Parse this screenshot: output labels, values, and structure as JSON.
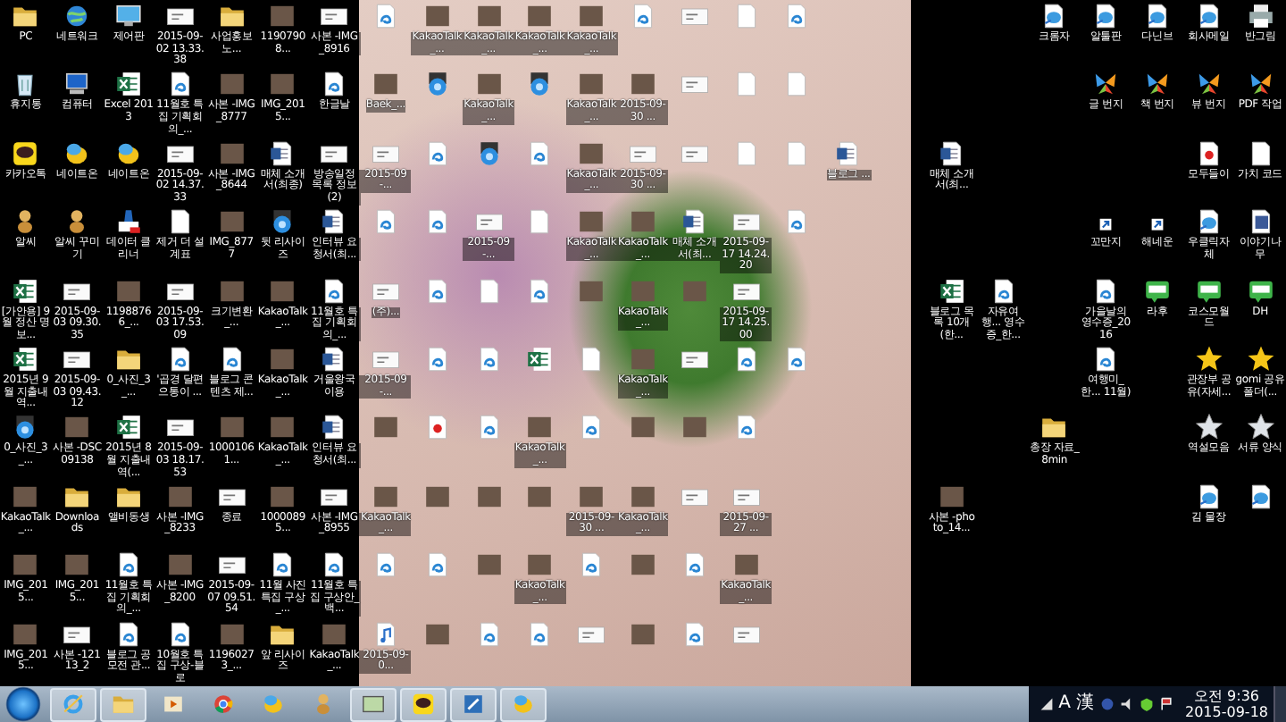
{
  "desktop": {
    "rows": [
      [
        {
          "kind": "folder",
          "label": "PC"
        },
        {
          "kind": "globe",
          "label": "네트워크"
        },
        {
          "kind": "monitor",
          "label": "제어판"
        },
        {
          "kind": "image",
          "label": "2015-09-02 13.33.38"
        },
        {
          "kind": "folder",
          "label": "사업홍보노..."
        },
        {
          "kind": "photo",
          "label": "11907908..."
        },
        {
          "kind": "image",
          "label": "사본 -IMG_8916"
        },
        {
          "kind": "edoc"
        },
        {
          "kind": "photo",
          "label": "KakaoTalk_..."
        },
        {
          "kind": "photo",
          "label": "KakaoTalk_..."
        },
        {
          "kind": "photo",
          "label": "KakaoTalk_..."
        },
        {
          "kind": "photo",
          "label": "KakaoTalk_..."
        },
        {
          "kind": "edoc"
        },
        {
          "kind": "image"
        },
        {
          "kind": "blank"
        },
        {
          "kind": "edoc"
        },
        {
          "kind": "empty"
        },
        {
          "kind": "empty"
        },
        {
          "kind": "empty"
        },
        {
          "kind": "empty"
        },
        {
          "kind": "ie",
          "label": "크롬자"
        },
        {
          "kind": "ie",
          "label": "알툴판"
        },
        {
          "kind": "ie",
          "label": "다닌브"
        },
        {
          "kind": "ie",
          "label": "회사메일"
        },
        {
          "kind": "printer",
          "label": "반그림"
        }
      ],
      [
        {
          "kind": "recycle",
          "label": "휴지통"
        },
        {
          "kind": "computer",
          "label": "컴퓨터"
        },
        {
          "kind": "excel",
          "label": "Excel 2013"
        },
        {
          "kind": "edoc",
          "label": "11월호 특집 기획회의_..."
        },
        {
          "kind": "photo",
          "label": "사본 -IMG_8777"
        },
        {
          "kind": "photo",
          "label": "IMG_2015..."
        },
        {
          "kind": "edoc",
          "label": "한글날"
        },
        {
          "kind": "photo",
          "label": "Baek_..."
        },
        {
          "kind": "zip"
        },
        {
          "kind": "photo",
          "label": "KakaoTalk_..."
        },
        {
          "kind": "zip"
        },
        {
          "kind": "photo",
          "label": "KakaoTalk_..."
        },
        {
          "kind": "photo",
          "label": "2015-09-30 ..."
        },
        {
          "kind": "image"
        },
        {
          "kind": "blank"
        },
        {
          "kind": "blank"
        },
        {
          "kind": "empty"
        },
        {
          "kind": "empty"
        },
        {
          "kind": "empty"
        },
        {
          "kind": "empty"
        },
        {
          "kind": "empty"
        },
        {
          "kind": "msn",
          "label": "글 번지"
        },
        {
          "kind": "msn",
          "label": "책 번지"
        },
        {
          "kind": "msn",
          "label": "뷰 번지"
        },
        {
          "kind": "msn",
          "label": "PDF 작업"
        }
      ],
      [
        {
          "kind": "kakao",
          "label": "카카오톡"
        },
        {
          "kind": "nateon",
          "label": "네이트온"
        },
        {
          "kind": "nateon",
          "label": "네이트온"
        },
        {
          "kind": "image",
          "label": "2015-09-02 14.37.33"
        },
        {
          "kind": "photo",
          "label": "사본 -IMG_8644"
        },
        {
          "kind": "word",
          "label": "매체 소개서(최종)"
        },
        {
          "kind": "image",
          "label": "방송일정 목록 정보(2)"
        },
        {
          "kind": "image",
          "label": "2015-09-..."
        },
        {
          "kind": "edoc"
        },
        {
          "kind": "zip"
        },
        {
          "kind": "edoc"
        },
        {
          "kind": "photo",
          "label": "KakaoTalk_..."
        },
        {
          "kind": "image",
          "label": "2015-09-30 ..."
        },
        {
          "kind": "image"
        },
        {
          "kind": "blank"
        },
        {
          "kind": "blank"
        },
        {
          "kind": "word",
          "label": "블로그 ..."
        },
        {
          "kind": "empty"
        },
        {
          "kind": "word",
          "label": "매체 소개서(최..."
        },
        {
          "kind": "empty"
        },
        {
          "kind": "empty"
        },
        {
          "kind": "empty"
        },
        {
          "kind": "empty"
        },
        {
          "kind": "pdf",
          "label": "모두들이"
        },
        {
          "kind": "blank",
          "label": "가치 코드"
        }
      ],
      [
        {
          "kind": "alsee",
          "label": "알씨"
        },
        {
          "kind": "alsee",
          "label": "알씨 꾸미기"
        },
        {
          "kind": "cleaner",
          "label": "데이터 클리너"
        },
        {
          "kind": "blank",
          "label": "제거 더 설계표"
        },
        {
          "kind": "photo",
          "label": "IMG_8777"
        },
        {
          "kind": "zip",
          "label": "뒷 리사이즈"
        },
        {
          "kind": "word",
          "label": "인터뷰 요청서(최..."
        },
        {
          "kind": "edoc"
        },
        {
          "kind": "edoc"
        },
        {
          "kind": "image",
          "label": "2015-09-..."
        },
        {
          "kind": "blank"
        },
        {
          "kind": "photo",
          "label": "KakaoTalk_..."
        },
        {
          "kind": "photo",
          "label": "KakaoTalk_..."
        },
        {
          "kind": "word",
          "label": "매체 소개서(최..."
        },
        {
          "kind": "image",
          "label": "2015-09-17 14.24.20"
        },
        {
          "kind": "edoc"
        },
        {
          "kind": "empty"
        },
        {
          "kind": "empty"
        },
        {
          "kind": "empty"
        },
        {
          "kind": "empty"
        },
        {
          "kind": "empty"
        },
        {
          "kind": "shortcut",
          "label": "꼬만지"
        },
        {
          "kind": "shortcut",
          "label": "해네운"
        },
        {
          "kind": "ie",
          "label": "우클릭자체"
        },
        {
          "kind": "facebook",
          "label": "이야기나무"
        }
      ],
      [
        {
          "kind": "excel",
          "label": "[가안용] 9월 정산 명보..."
        },
        {
          "kind": "image",
          "label": "2015-09-03 09.30.35"
        },
        {
          "kind": "photo",
          "label": "11988766_..."
        },
        {
          "kind": "image",
          "label": "2015-09-03 17.53.09"
        },
        {
          "kind": "photo",
          "label": "크기변환_..."
        },
        {
          "kind": "photo",
          "label": "KakaoTalk_..."
        },
        {
          "kind": "edoc",
          "label": "11월호 특집 기획회의_..."
        },
        {
          "kind": "image",
          "label": "(주)..."
        },
        {
          "kind": "edoc"
        },
        {
          "kind": "blank"
        },
        {
          "kind": "edoc"
        },
        {
          "kind": "photo"
        },
        {
          "kind": "photo",
          "label": "KakaoTalk_..."
        },
        {
          "kind": "photo"
        },
        {
          "kind": "image",
          "label": "2015-09-17 14.25.00"
        },
        {
          "kind": "empty"
        },
        {
          "kind": "empty"
        },
        {
          "kind": "empty"
        },
        {
          "kind": "excel",
          "label": "블로그 목록 10개 (한..."
        },
        {
          "kind": "edoc",
          "label": "자유여행... 영수증_한..."
        },
        {
          "kind": "empty"
        },
        {
          "kind": "edoc",
          "label": "가을날의 영수증_2016"
        },
        {
          "kind": "blog",
          "label": "라후"
        },
        {
          "kind": "blog",
          "label": "코스모월드"
        },
        {
          "kind": "blog",
          "label": "DH"
        }
      ],
      [
        {
          "kind": "excel",
          "label": "2015년 9월 지출내역..."
        },
        {
          "kind": "image",
          "label": "2015-09-03 09.43.12"
        },
        {
          "kind": "folder",
          "label": "0_사진_3_..."
        },
        {
          "kind": "edoc",
          "label": "'곱경 달편 으통이 ..."
        },
        {
          "kind": "edoc",
          "label": "블로그 콘텐츠 제..."
        },
        {
          "kind": "photo",
          "label": "KakaoTalk_..."
        },
        {
          "kind": "word",
          "label": "거울왕국이용"
        },
        {
          "kind": "image",
          "label": "2015-09-..."
        },
        {
          "kind": "edoc"
        },
        {
          "kind": "edoc"
        },
        {
          "kind": "excel"
        },
        {
          "kind": "blank"
        },
        {
          "kind": "photo",
          "label": "KakaoTalk_..."
        },
        {
          "kind": "image"
        },
        {
          "kind": "edoc"
        },
        {
          "kind": "edoc"
        },
        {
          "kind": "empty"
        },
        {
          "kind": "empty"
        },
        {
          "kind": "empty"
        },
        {
          "kind": "empty"
        },
        {
          "kind": "empty"
        },
        {
          "kind": "edoc",
          "label": "여행미_한... 11월)"
        },
        {
          "kind": "empty"
        },
        {
          "kind": "star",
          "label": "관장부 공유(자세..."
        },
        {
          "kind": "star",
          "label": "gomi 공유폴더(..."
        }
      ],
      [
        {
          "kind": "zip",
          "label": "0_사진_3_..."
        },
        {
          "kind": "photo",
          "label": "사본 -DSC09138"
        },
        {
          "kind": "excel",
          "label": "2015년 8월 지출내역(..."
        },
        {
          "kind": "image",
          "label": "2015-09-03 18.17.53"
        },
        {
          "kind": "photo",
          "label": "10001061..."
        },
        {
          "kind": "photo",
          "label": "KakaoTalk_..."
        },
        {
          "kind": "word",
          "label": "인터뷰 요청서(최..."
        },
        {
          "kind": "photo"
        },
        {
          "kind": "pdf"
        },
        {
          "kind": "edoc"
        },
        {
          "kind": "photo",
          "label": "KakaoTalk_..."
        },
        {
          "kind": "edoc"
        },
        {
          "kind": "photo"
        },
        {
          "kind": "photo"
        },
        {
          "kind": "edoc"
        },
        {
          "kind": "empty"
        },
        {
          "kind": "empty"
        },
        {
          "kind": "empty"
        },
        {
          "kind": "empty"
        },
        {
          "kind": "empty"
        },
        {
          "kind": "folder",
          "label": "총장 자료_8min"
        },
        {
          "kind": "empty"
        },
        {
          "kind": "empty"
        },
        {
          "kind": "starout",
          "label": "역설모음"
        },
        {
          "kind": "starout",
          "label": "서류 양식"
        }
      ],
      [
        {
          "kind": "photo",
          "label": "KakaoTalk_..."
        },
        {
          "kind": "folder",
          "label": "Downloads"
        },
        {
          "kind": "folder",
          "label": "앨비동생"
        },
        {
          "kind": "photo",
          "label": "사본 -IMG_8233"
        },
        {
          "kind": "image",
          "label": "종료"
        },
        {
          "kind": "photo",
          "label": "10000895..."
        },
        {
          "kind": "image",
          "label": "사본 -IMG_8955"
        },
        {
          "kind": "photo",
          "label": "KakaoTalk_..."
        },
        {
          "kind": "photo"
        },
        {
          "kind": "photo"
        },
        {
          "kind": "photo"
        },
        {
          "kind": "photo",
          "label": "2015-09-30 ..."
        },
        {
          "kind": "photo",
          "label": "KakaoTalk_..."
        },
        {
          "kind": "image"
        },
        {
          "kind": "image",
          "label": "2015-09-27 ..."
        },
        {
          "kind": "empty"
        },
        {
          "kind": "empty"
        },
        {
          "kind": "empty"
        },
        {
          "kind": "photo",
          "label": "사본 -photo_14..."
        },
        {
          "kind": "empty"
        },
        {
          "kind": "empty"
        },
        {
          "kind": "empty"
        },
        {
          "kind": "empty"
        },
        {
          "kind": "ie",
          "label": "김 물장"
        },
        {
          "kind": "ie"
        }
      ],
      [
        {
          "kind": "photo",
          "label": "IMG_2015..."
        },
        {
          "kind": "photo",
          "label": "IMG_2015..."
        },
        {
          "kind": "edoc",
          "label": "11월호 특집 기획회의_..."
        },
        {
          "kind": "photo",
          "label": "사본 -IMG_8200"
        },
        {
          "kind": "image",
          "label": "2015-09-07 09.51.54"
        },
        {
          "kind": "edoc",
          "label": "11월 사진 특집 구상_..."
        },
        {
          "kind": "edoc",
          "label": "11월호 특집 구상안_백..."
        },
        {
          "kind": "edoc"
        },
        {
          "kind": "edoc"
        },
        {
          "kind": "photo"
        },
        {
          "kind": "photo",
          "label": "KakaoTalk_..."
        },
        {
          "kind": "edoc"
        },
        {
          "kind": "photo"
        },
        {
          "kind": "edoc"
        },
        {
          "kind": "photo",
          "label": "KakaoTalk_..."
        },
        {
          "kind": "empty"
        },
        {
          "kind": "empty"
        },
        {
          "kind": "empty"
        },
        {
          "kind": "empty"
        },
        {
          "kind": "empty"
        },
        {
          "kind": "empty"
        },
        {
          "kind": "empty"
        },
        {
          "kind": "empty"
        },
        {
          "kind": "empty"
        },
        {
          "kind": "empty"
        }
      ],
      [
        {
          "kind": "photo",
          "label": "IMG_2015..."
        },
        {
          "kind": "image",
          "label": "사본 -12113_2"
        },
        {
          "kind": "edoc",
          "label": "블로그 공모전 관..."
        },
        {
          "kind": "edoc",
          "label": "10월호 특집 구상-블로"
        },
        {
          "kind": "photo",
          "label": "11960273_..."
        },
        {
          "kind": "folder",
          "label": "앞 리사이즈"
        },
        {
          "kind": "photo",
          "label": "KakaoTalk_..."
        },
        {
          "kind": "music",
          "label": "2015-09-0..."
        },
        {
          "kind": "photo"
        },
        {
          "kind": "edoc"
        },
        {
          "kind": "edoc"
        },
        {
          "kind": "image"
        },
        {
          "kind": "photo"
        },
        {
          "kind": "edoc"
        },
        {
          "kind": "image"
        },
        {
          "kind": "empty"
        },
        {
          "kind": "empty"
        },
        {
          "kind": "empty"
        },
        {
          "kind": "empty"
        },
        {
          "kind": "empty"
        },
        {
          "kind": "empty"
        },
        {
          "kind": "empty"
        },
        {
          "kind": "empty"
        },
        {
          "kind": "empty"
        },
        {
          "kind": "empty"
        }
      ]
    ]
  },
  "taskbar": {
    "items": [
      {
        "kind": "ie",
        "open": true
      },
      {
        "kind": "folder",
        "open": true
      },
      {
        "kind": "media",
        "open": false
      },
      {
        "kind": "chrome",
        "open": false
      },
      {
        "kind": "nateon",
        "open": false
      },
      {
        "kind": "alsee",
        "open": false
      },
      {
        "kind": "window",
        "open": true
      },
      {
        "kind": "kakao",
        "open": true
      },
      {
        "kind": "app",
        "open": true
      },
      {
        "kind": "nateon",
        "open": true
      }
    ],
    "tray": {
      "ime": "A",
      "hanja": "漢",
      "time": "오전 9:36",
      "date": "2015-09-18"
    }
  }
}
